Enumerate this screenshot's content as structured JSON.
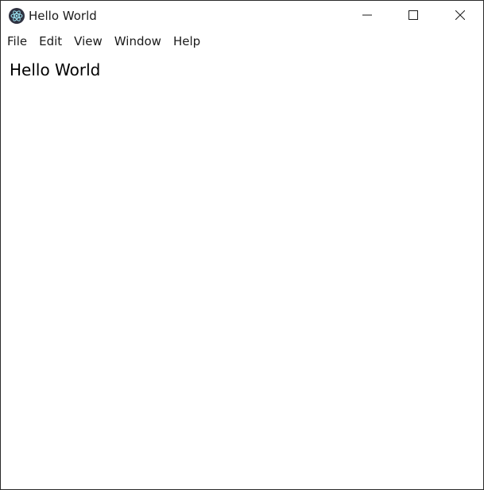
{
  "window": {
    "title": "Hello World",
    "app_icon": "electron-atom-icon",
    "controls": {
      "minimize_icon": "minimize-icon",
      "maximize_icon": "maximize-icon",
      "close_icon": "close-icon"
    }
  },
  "menubar": {
    "items": [
      {
        "label": "File"
      },
      {
        "label": "Edit"
      },
      {
        "label": "View"
      },
      {
        "label": "Window"
      },
      {
        "label": "Help"
      }
    ]
  },
  "content": {
    "heading": "Hello World"
  },
  "colors": {
    "background": "#ffffff",
    "border": "#2b2b2b",
    "text": "#1a1a1a",
    "icon": "#2f3241"
  }
}
